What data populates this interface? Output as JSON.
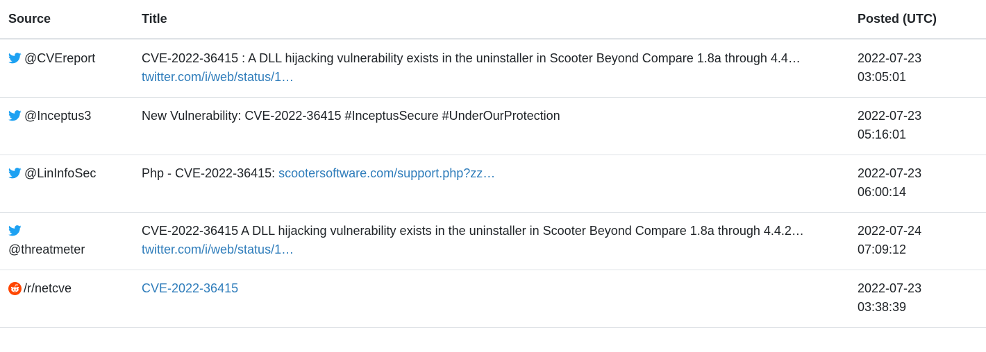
{
  "columns": {
    "source": "Source",
    "title": "Title",
    "posted": "Posted (UTC)"
  },
  "rows": [
    {
      "source_icon": "twitter-icon",
      "source": "@CVEreport",
      "title_text": "CVE-2022-36415 : A DLL hijacking vulnerability exists in the uninstaller in Scooter Beyond Compare 1.8a through 4.4… ",
      "title_link": "twitter.com/i/web/status/1…",
      "posted_date": "2022-07-23",
      "posted_time": "03:05:01"
    },
    {
      "source_icon": "twitter-icon",
      "source": "@Inceptus3",
      "title_text": "New Vulnerability: CVE-2022-36415 #InceptusSecure #UnderOurProtection",
      "title_link": "",
      "posted_date": "2022-07-23",
      "posted_time": "05:16:01"
    },
    {
      "source_icon": "twitter-icon",
      "source": "@LinInfoSec",
      "title_text": "Php - CVE-2022-36415: ",
      "title_link": "scootersoftware.com/support.php?zz…",
      "posted_date": "2022-07-23",
      "posted_time": "06:00:14"
    },
    {
      "source_icon": "twitter-icon",
      "source": "@threatmeter",
      "title_text": "CVE-2022-36415 A DLL hijacking vulnerability exists in the uninstaller in Scooter Beyond Compare 1.8a through 4.4.2… ",
      "title_link": "twitter.com/i/web/status/1…",
      "posted_date": "2022-07-24",
      "posted_time": "07:09:12"
    },
    {
      "source_icon": "reddit-icon",
      "source": "/r/netcve",
      "title_text": "",
      "title_link": "CVE-2022-36415",
      "posted_date": "2022-07-23",
      "posted_time": "03:38:39"
    }
  ],
  "colors": {
    "twitter": "#1da1f2",
    "reddit": "#ff4500",
    "link": "#2f7dbb",
    "border": "#dee2e6"
  }
}
